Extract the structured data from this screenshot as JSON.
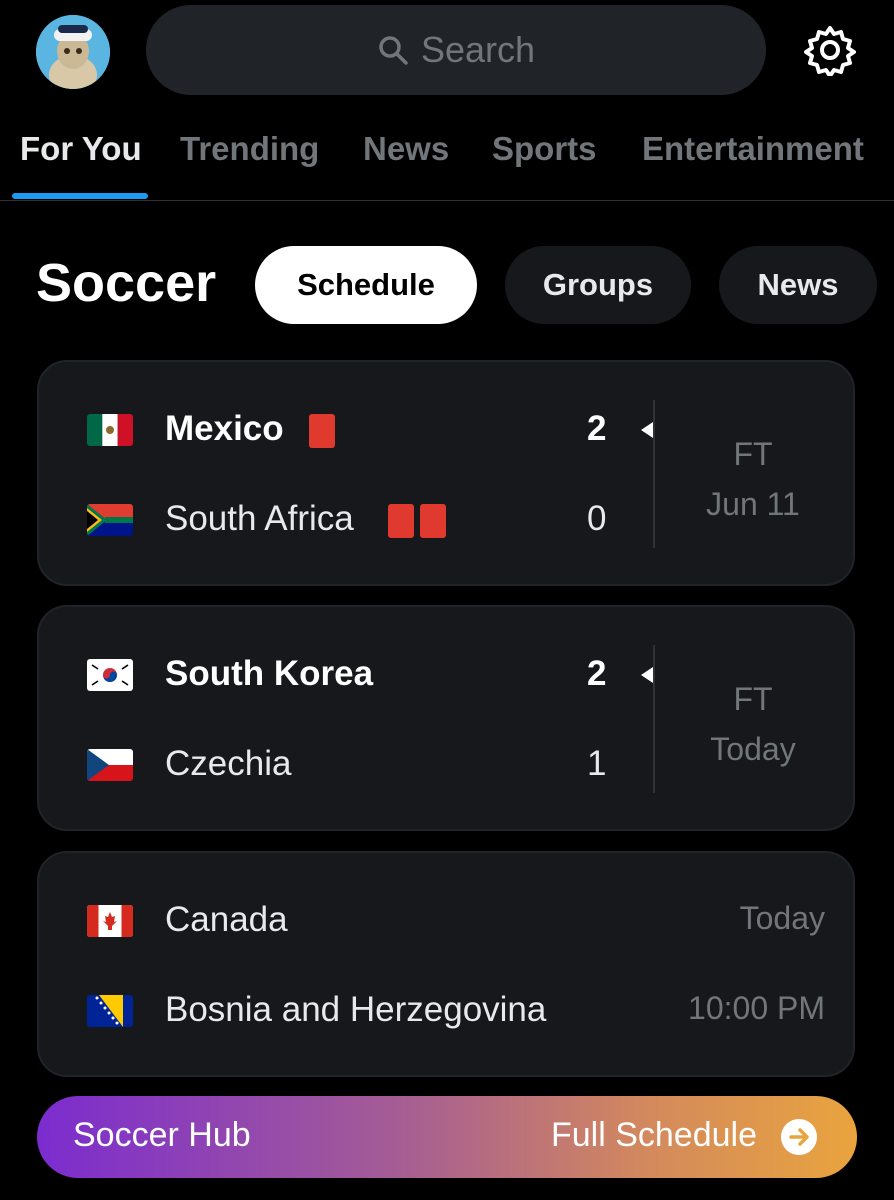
{
  "header": {
    "search_placeholder": "Search",
    "avatar_icon": "profile-avatar",
    "settings_icon": "gear-icon"
  },
  "tabs": [
    {
      "label": "For You",
      "active": true
    },
    {
      "label": "Trending"
    },
    {
      "label": "News"
    },
    {
      "label": "Sports"
    },
    {
      "label": "Entertainment"
    }
  ],
  "section": {
    "title": "Soccer",
    "pills": [
      {
        "label": "Schedule",
        "active": true
      },
      {
        "label": "Groups"
      },
      {
        "label": "News"
      }
    ]
  },
  "matches": [
    {
      "home": {
        "name": "Mexico",
        "score": "2",
        "red_cards": 1,
        "winner": true,
        "flag": "mexico-flag"
      },
      "away": {
        "name": "South Africa",
        "score": "0",
        "red_cards": 2,
        "winner": false,
        "flag": "south-africa-flag"
      },
      "status": "FT",
      "date": "Jun 11"
    },
    {
      "home": {
        "name": "South Korea",
        "score": "2",
        "red_cards": 0,
        "winner": true,
        "flag": "south-korea-flag"
      },
      "away": {
        "name": "Czechia",
        "score": "1",
        "red_cards": 0,
        "winner": false,
        "flag": "czechia-flag"
      },
      "status": "FT",
      "date": "Today"
    },
    {
      "home": {
        "name": "Canada",
        "flag": "canada-flag"
      },
      "away": {
        "name": "Bosnia and Herzegovina",
        "flag": "bosnia-flag"
      },
      "date": "Today",
      "time": "10:00 PM"
    }
  ],
  "footer": {
    "left_label": "Soccer Hub",
    "right_label": "Full Schedule",
    "arrow_icon": "arrow-right-circle-icon"
  },
  "colors": {
    "accent": "#1d9bf0",
    "red_card": "#e03a2e",
    "muted": "#71767b"
  }
}
